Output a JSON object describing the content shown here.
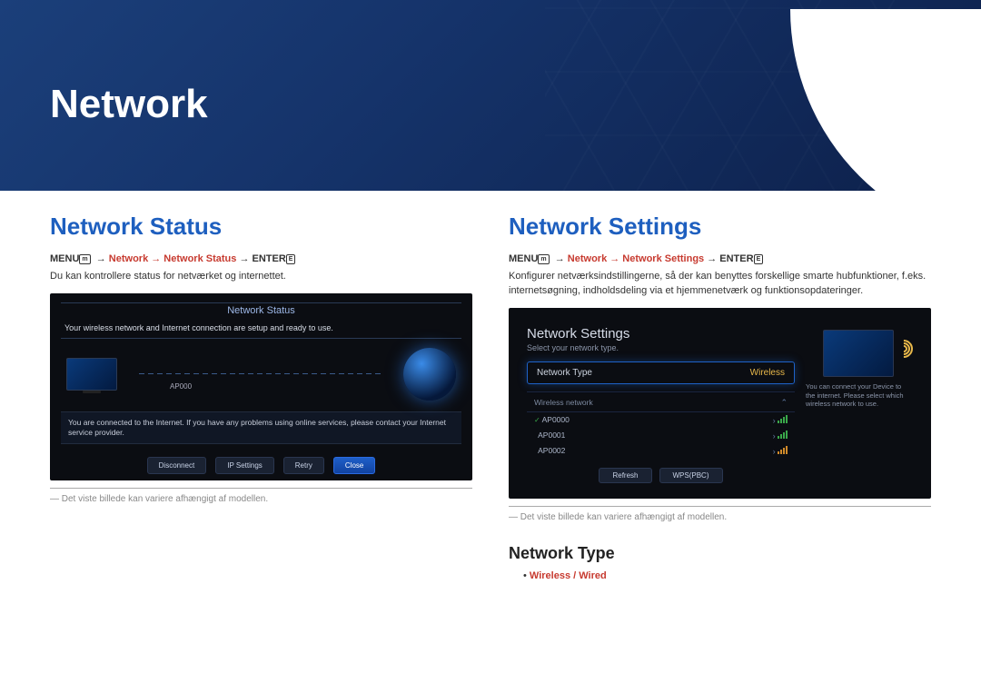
{
  "banner": {
    "title": "Network"
  },
  "left": {
    "heading": "Network Status",
    "path": {
      "menu": "MENU",
      "crumb": "Network → Network Status",
      "enter": "ENTER"
    },
    "desc": "Du kan kontrollere status for netværket og internettet.",
    "shot": {
      "title": "Network Status",
      "msg": "Your wireless network and Internet connection are setup and ready to use.",
      "ap": "AP000",
      "warn": "You are connected to the Internet. If you have any problems using online services, please contact your Internet service provider.",
      "btns": {
        "disconnect": "Disconnect",
        "ip": "IP Settings",
        "retry": "Retry",
        "close": "Close"
      }
    },
    "note": "― Det viste billede kan variere afhængigt af modellen."
  },
  "right": {
    "heading": "Network Settings",
    "path": {
      "menu": "MENU",
      "crumb": "Network → Network Settings",
      "enter": "ENTER"
    },
    "desc": "Konfigurer netværksindstillingerne, så der kan benyttes forskellige smarte hubfunktioner, f.eks. internetsøgning, indholdsdeling via et hjemmenetværk og funktionsopdateringer.",
    "shot": {
      "title": "Network Settings",
      "sub": "Select your network type.",
      "type_label": "Network Type",
      "type_value": "Wireless",
      "section": "Wireless network",
      "rows": [
        {
          "name": "AP0000",
          "checked": true,
          "signal": "green"
        },
        {
          "name": "AP0001",
          "checked": false,
          "signal": "green"
        },
        {
          "name": "AP0002",
          "checked": false,
          "signal": "amber"
        }
      ],
      "btns": {
        "refresh": "Refresh",
        "wps": "WPS(PBC)"
      },
      "side_text": "You can connect your Device to the internet. Please select which wireless network to use."
    },
    "note": "― Det viste billede kan variere afhængigt af modellen.",
    "subheading": "Network Type",
    "options": "Wireless / Wired"
  }
}
